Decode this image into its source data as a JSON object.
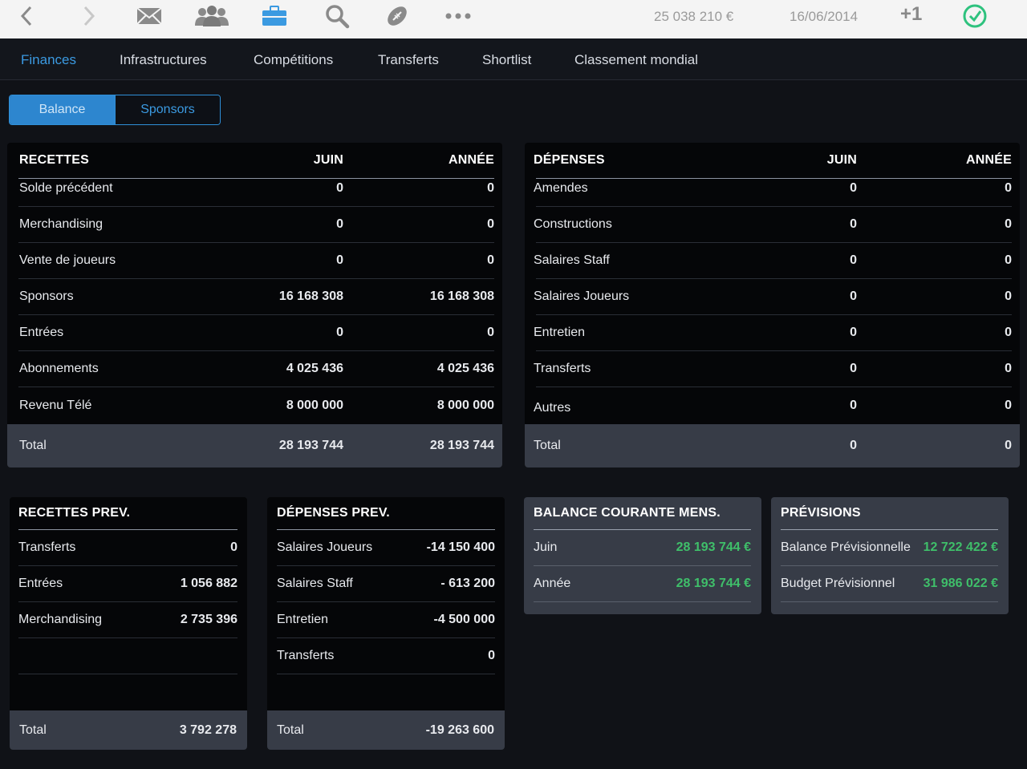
{
  "toolbar": {
    "icons": [
      "back-icon",
      "forward-icon",
      "mail-icon",
      "team-icon",
      "briefcase-icon",
      "search-icon",
      "ball-icon",
      "more-icon",
      "clock-check-icon"
    ],
    "balance": "25 038 210 €",
    "date": "16/06/2014",
    "day_step": "+1",
    "accent": "#3b9ae1",
    "ok_color": "#2ec27e"
  },
  "nav": {
    "items": [
      "Finances",
      "Infrastructures",
      "Compétitions",
      "Transferts",
      "Shortlist",
      "Classement mondial"
    ],
    "active": "Finances"
  },
  "segment": {
    "balance": "Balance",
    "sponsors": "Sponsors"
  },
  "recettes": {
    "title": "RECETTES",
    "col_month": "JUIN",
    "col_year": "ANNÉE",
    "rows": [
      {
        "label": "Solde précédent",
        "month": "0",
        "year": "0"
      },
      {
        "label": "Merchandising",
        "month": "0",
        "year": "0"
      },
      {
        "label": "Vente de joueurs",
        "month": "0",
        "year": "0"
      },
      {
        "label": "Sponsors",
        "month": "16 168 308",
        "year": "16 168 308"
      },
      {
        "label": "Entrées",
        "month": "0",
        "year": "0"
      },
      {
        "label": "Abonnements",
        "month": "4 025 436",
        "year": "4 025 436"
      },
      {
        "label": "Revenu Télé",
        "month": "8 000 000",
        "year": "8 000 000"
      }
    ],
    "total": {
      "label": "Total",
      "month": "28 193 744",
      "year": "28 193 744"
    }
  },
  "depenses": {
    "title": "DÉPENSES",
    "col_month": "JUIN",
    "col_year": "ANNÉE",
    "rows": [
      {
        "label": "Amendes",
        "month": "0",
        "year": "0"
      },
      {
        "label": "Constructions",
        "month": "0",
        "year": "0"
      },
      {
        "label": "Salaires Staff",
        "month": "0",
        "year": "0"
      },
      {
        "label": "Salaires Joueurs",
        "month": "0",
        "year": "0"
      },
      {
        "label": "Entretien",
        "month": "0",
        "year": "0"
      },
      {
        "label": "Transferts",
        "month": "0",
        "year": "0"
      },
      {
        "label": "Autres",
        "month": "0",
        "year": "0"
      }
    ],
    "total": {
      "label": "Total",
      "month": "0",
      "year": "0"
    }
  },
  "recettes_prev": {
    "title": "RECETTES PREV.",
    "rows": [
      {
        "label": "Transferts",
        "value": "0"
      },
      {
        "label": "Entrées",
        "value": "1 056 882"
      },
      {
        "label": "Merchandising",
        "value": "2 735 396"
      }
    ],
    "total": {
      "label": "Total",
      "value": "3 792 278"
    }
  },
  "depenses_prev": {
    "title": "DÉPENSES PREV.",
    "rows": [
      {
        "label": "Salaires Joueurs",
        "value": "-14 150 400"
      },
      {
        "label": "Salaires Staff",
        "value": "- 613 200"
      },
      {
        "label": "Entretien",
        "value": "-4 500 000"
      },
      {
        "label": "Transferts",
        "value": "0"
      }
    ],
    "total": {
      "label": "Total",
      "value": "-19 263 600"
    }
  },
  "balance_courante": {
    "title": "BALANCE COURANTE MENS.",
    "rows": [
      {
        "label": "Juin",
        "value": "28 193 744 €"
      },
      {
        "label": "Année",
        "value": "28 193 744 €"
      }
    ]
  },
  "previsions": {
    "title": "PRÉVISIONS",
    "rows": [
      {
        "label": "Balance Prévisionnelle",
        "value": "12 722 422 €"
      },
      {
        "label": "Budget Prévisionnel",
        "value": "31 986 022 €"
      }
    ]
  }
}
